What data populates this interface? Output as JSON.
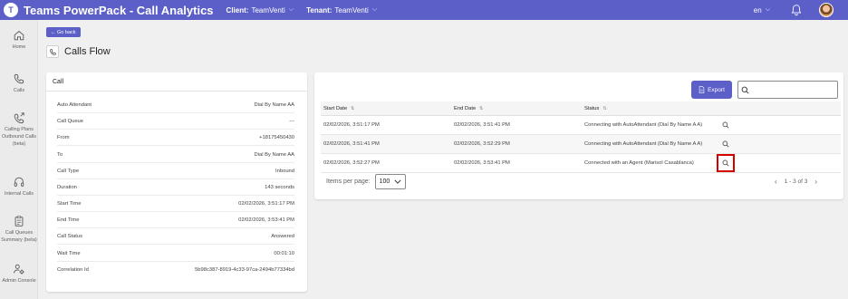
{
  "topbar": {
    "title": "Teams PowerPack - Call Analytics",
    "client_label": "Client:",
    "client_value": "TeamVenti",
    "tenant_label": "Tenant:",
    "tenant_value": "TeamVenti",
    "language": "en",
    "logo_letter": "T"
  },
  "rail": {
    "items": [
      {
        "label": "Home",
        "icon": "home-icon"
      },
      {
        "label": "Calls",
        "icon": "phone-icon"
      },
      {
        "label1": "Calling Plans",
        "label2": "Outbound Calls",
        "label3": "(beta)",
        "icon": "outbound-call-icon"
      },
      {
        "label": "Internal Calls",
        "icon": "headset-icon"
      },
      {
        "label1": "Call Queues",
        "label2": "Summary (beta)",
        "icon": "clipboard-icon"
      },
      {
        "label": "Admin Console",
        "icon": "admin-settings-icon"
      }
    ]
  },
  "nav": {
    "back_label": "← Go back"
  },
  "page": {
    "title": "Calls Flow"
  },
  "call_card": {
    "title": "Call",
    "rows": [
      {
        "label": "Auto Attendant",
        "value": "Dial By Name AA"
      },
      {
        "label": "Call Queue",
        "value": "---"
      },
      {
        "label": "From",
        "value": "+18175450430"
      },
      {
        "label": "To",
        "value": "Dial By Name AA"
      },
      {
        "label": "Call Type",
        "value": "Inbound"
      },
      {
        "label": "Duration",
        "value": "143 seconds"
      },
      {
        "label": "Start Time",
        "value": "02/02/2026, 3:51:17 PM"
      },
      {
        "label": "End Time",
        "value": "02/02/2026, 3:53:41 PM"
      },
      {
        "label": "Call Status",
        "value": "Answered"
      },
      {
        "label": "Wait Time",
        "value": "00:01:10"
      },
      {
        "label": "Correlation Id",
        "value": "5b98c387-8919-4c33-97ca-2494b77334bd"
      }
    ]
  },
  "flow_table": {
    "export_label": "Export",
    "search_placeholder": "",
    "columns": [
      "Start Date",
      "End Date",
      "Status"
    ],
    "sort_glyph": "⇅",
    "rows": [
      {
        "start": "02/02/2026, 3:51:17 PM",
        "end": "02/02/2026, 3:51:41 PM",
        "status": "Connecting with AutoAttendant (Dial By Name A A)"
      },
      {
        "start": "02/02/2026, 3:51:41 PM",
        "end": "02/02/2026, 3:52:29 PM",
        "status": "Connecting with AutoAttendant (Dial By Name A A)"
      },
      {
        "start": "02/02/2026, 3:52:27 PM",
        "end": "02/02/2026, 3:53:41 PM",
        "status": "Connected with an Agent (Marisol Casablanca)"
      }
    ],
    "items_per_page_label": "Items per page:",
    "items_per_page_value": "100",
    "page_range": "1 - 3 of 3",
    "highlight_color": "#d40000"
  },
  "colors": {
    "accent": "#5b5fc7"
  }
}
